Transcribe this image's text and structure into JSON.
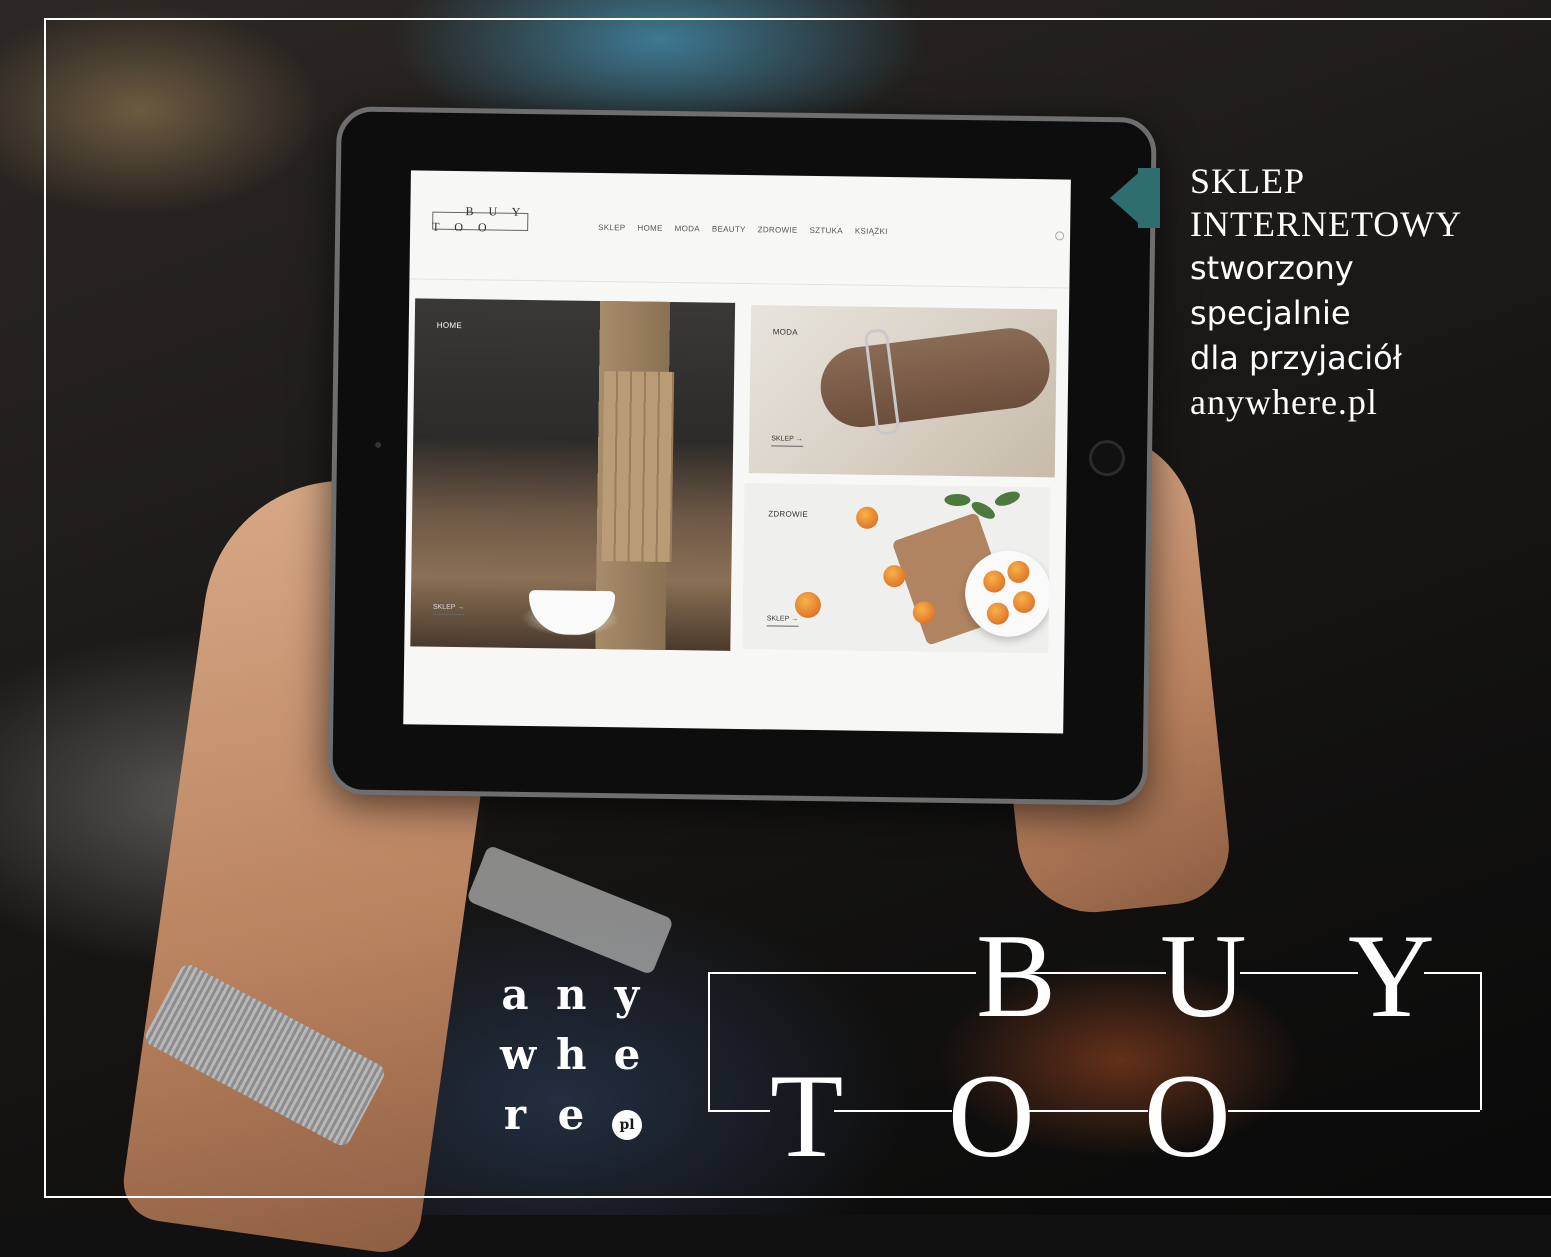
{
  "tablet": {
    "site": {
      "logo": {
        "row1": "B U Y",
        "row2": "T O O"
      },
      "nav": [
        "SKLEP",
        "HOME",
        "MODA",
        "BEAUTY",
        "ZDROWIE",
        "SZTUKA",
        "KSIĄŻKI"
      ],
      "tiles": {
        "home": {
          "label": "HOME",
          "cta": "SKLEP →"
        },
        "moda": {
          "label": "MODA",
          "cta": "SKLEP →"
        },
        "zdrowie": {
          "label": "ZDROWIE",
          "cta": "SKLEP →"
        }
      }
    }
  },
  "tagline": {
    "line1": "SKLEP",
    "line2": "INTERNETOWY",
    "line3": "stworzony",
    "line4": "specjalnie",
    "line5": "dla przyjaciół",
    "line6": "anywhere.pl"
  },
  "anywhere_logo": {
    "row1": [
      "a",
      "n",
      "y"
    ],
    "row2": [
      "w",
      "h",
      "e"
    ],
    "row3": [
      "r",
      "e"
    ],
    "badge": "pl"
  },
  "buytoo_logo": {
    "letters_top": [
      "B",
      "U",
      "Y"
    ],
    "letters_bottom": [
      "T",
      "O",
      "O"
    ]
  },
  "colors": {
    "accent": "#2e6e6e",
    "frame": "#ffffff"
  }
}
